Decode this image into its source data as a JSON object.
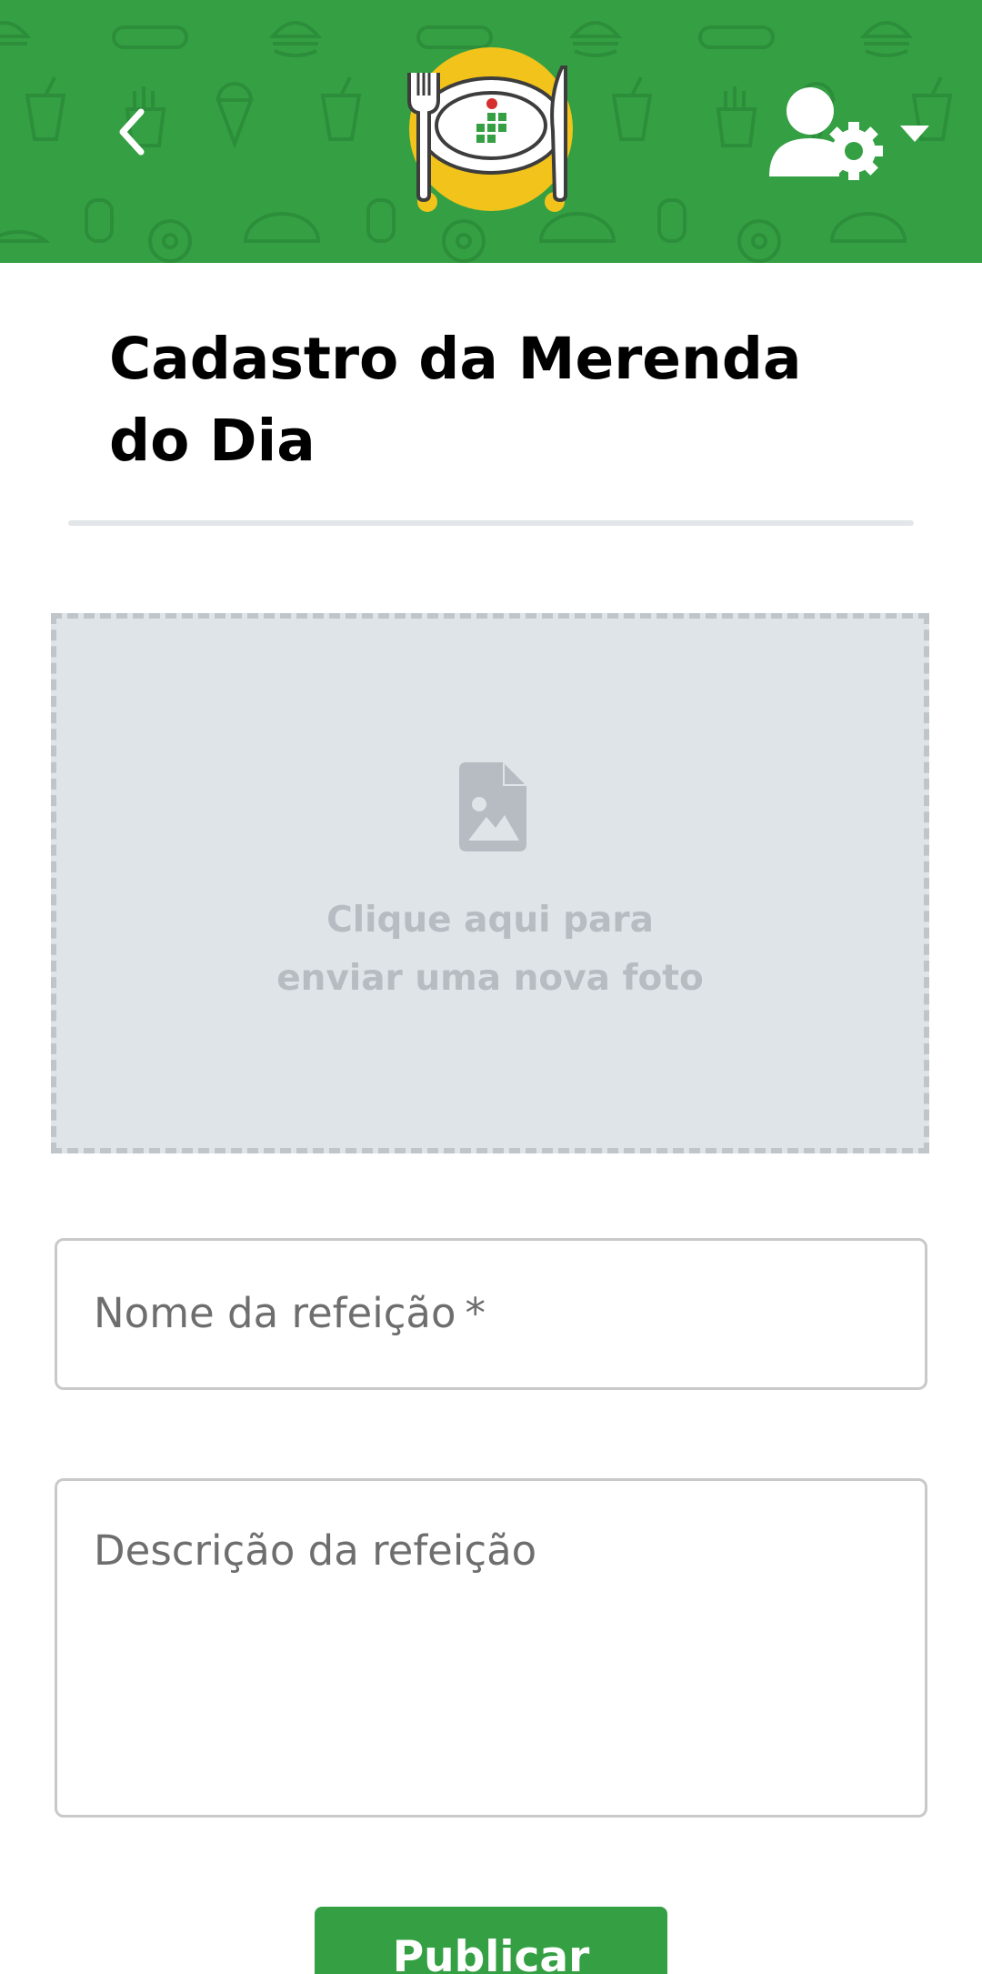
{
  "header": {
    "back_icon": "chevron-left-icon",
    "logo_icon": "plate-with-cutlery-logo",
    "user_menu_icons": [
      "user-settings-icon",
      "caret-down-icon"
    ],
    "colors": {
      "primary": "#34a043",
      "logo_yellow": "#f2c31b"
    }
  },
  "page": {
    "title": "Cadastro da Merenda do Dia"
  },
  "upload": {
    "icon": "image-file-icon",
    "line1": "Clique aqui para",
    "line2": "enviar uma nova foto"
  },
  "form": {
    "meal_name_placeholder": "Nome da refeição",
    "required_mark": "*",
    "meal_description_placeholder": "Descrição da refeição"
  },
  "actions": {
    "publish_label": "Publicar"
  }
}
